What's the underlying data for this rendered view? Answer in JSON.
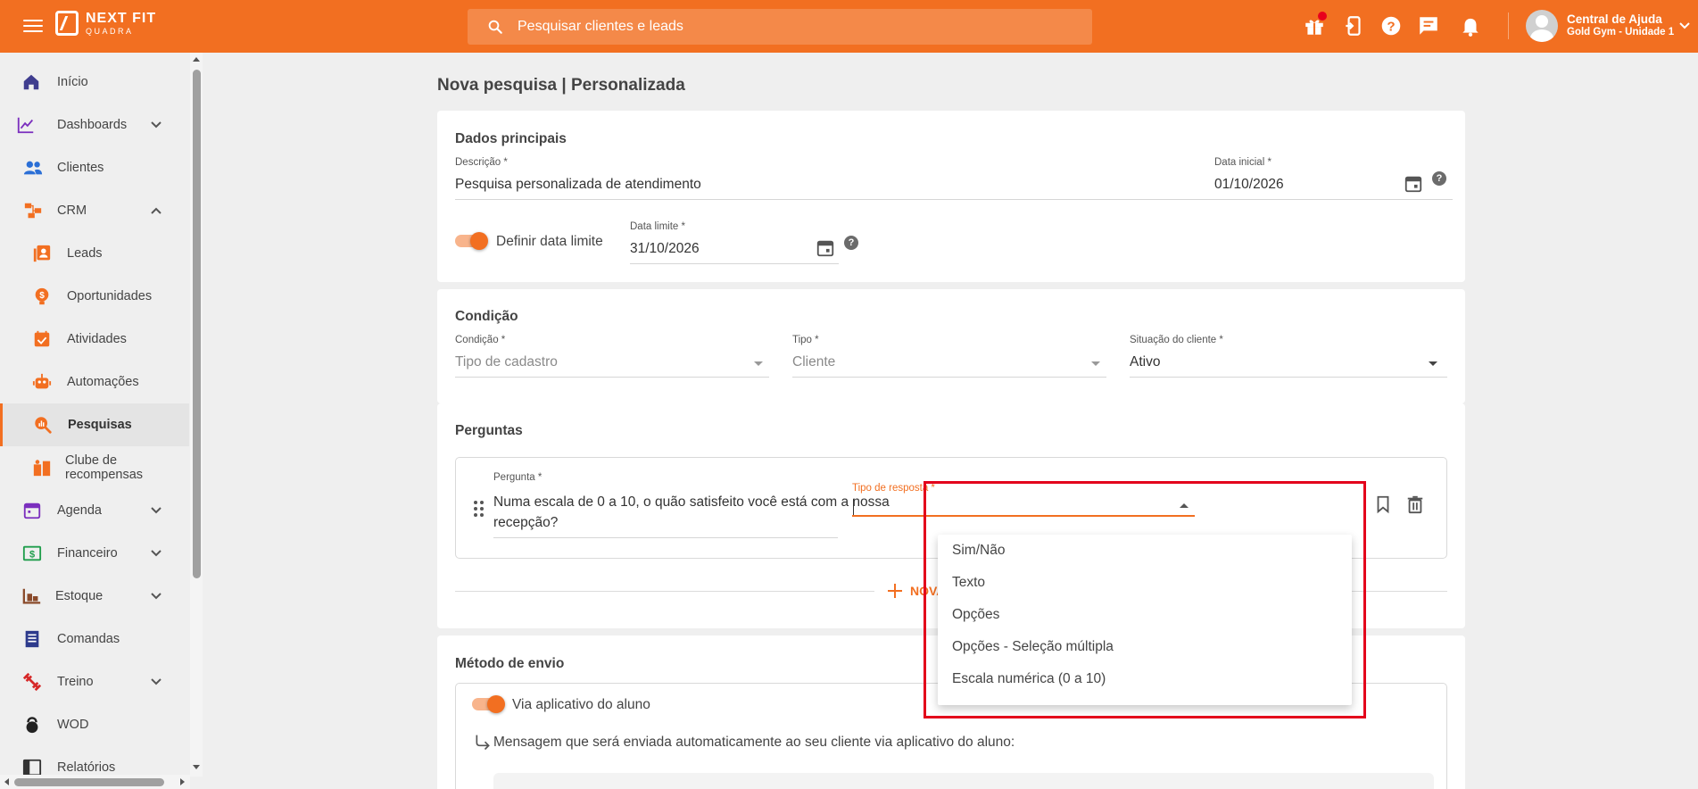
{
  "header": {
    "logo_line1": "NEXT FIT",
    "logo_line2": "QUADRA",
    "search_placeholder": "Pesquisar clientes e leads",
    "user_name": "Central de Ajuda",
    "user_unit": "Gold Gym - Unidade 1",
    "icons": [
      "menu-icon",
      "gift-icon",
      "mobile-exit-icon",
      "help-icon",
      "chat-icon",
      "bell-icon"
    ],
    "accent_color": "#f26f21"
  },
  "sidebar": {
    "items": [
      {
        "label": "Início",
        "icon": "home-icon",
        "color": "#3f3d8f"
      },
      {
        "label": "Dashboards",
        "icon": "chart-line-icon",
        "color": "#7b2fbe",
        "expandable": true
      },
      {
        "label": "Clientes",
        "icon": "people-icon",
        "color": "#2b6fd6"
      },
      {
        "label": "CRM",
        "icon": "crm-icon",
        "color": "#f26f21",
        "expandable": true,
        "expanded": true
      },
      {
        "label": "Leads",
        "icon": "contacts-icon",
        "color": "#f26f21",
        "sub": true
      },
      {
        "label": "Oportunidades",
        "icon": "lightbulb-icon",
        "color": "#f26f21",
        "sub": true
      },
      {
        "label": "Atividades",
        "icon": "calendar-check-icon",
        "color": "#f26f21",
        "sub": true
      },
      {
        "label": "Automações",
        "icon": "robot-icon",
        "color": "#f26f21",
        "sub": true
      },
      {
        "label": "Pesquisas",
        "icon": "search-chart-icon",
        "color": "#f26f21",
        "sub": true,
        "active": true
      },
      {
        "label": "Clube de recompensas",
        "icon": "rewards-icon",
        "color": "#f26f21",
        "sub": true
      },
      {
        "label": "Agenda",
        "icon": "calendar-icon",
        "color": "#7b2fbe",
        "expandable": true
      },
      {
        "label": "Financeiro",
        "icon": "money-icon",
        "color": "#1f9d4b",
        "expandable": true
      },
      {
        "label": "Estoque",
        "icon": "stock-icon",
        "color": "#8a4a2a",
        "expandable": true
      },
      {
        "label": "Comandas",
        "icon": "receipt-icon",
        "color": "#2d3a8c"
      },
      {
        "label": "Treino",
        "icon": "dumbbell-icon",
        "color": "#d62828",
        "expandable": true
      },
      {
        "label": "WOD",
        "icon": "kettlebell-icon",
        "color": "#222222"
      },
      {
        "label": "Relatórios",
        "icon": "reports-icon",
        "color": "#333333"
      }
    ]
  },
  "page": {
    "title": "Nova pesquisa | Personalizada"
  },
  "dados": {
    "title": "Dados principais",
    "descricao_label": "Descrição *",
    "descricao_value": "Pesquisa personalizada de atendimento",
    "data_inicial_label": "Data inicial *",
    "data_inicial_value": "01/10/2026",
    "definir_label": "Definir data limite",
    "definir_enabled": true,
    "data_limite_label": "Data limite *",
    "data_limite_value": "31/10/2026",
    "help": "?"
  },
  "condicao": {
    "title": "Condição",
    "condicao_label": "Condição *",
    "condicao_value": "Tipo de cadastro",
    "tipo_label": "Tipo *",
    "tipo_value": "Cliente",
    "situacao_label": "Situação do cliente *",
    "situacao_value": "Ativo"
  },
  "perguntas": {
    "title": "Perguntas",
    "pergunta_label": "Pergunta *",
    "pergunta_line1": "Numa escala de 0 a 10, o quão satisfeito você está com a nossa",
    "pergunta_line2": "recepção?",
    "tipo_resposta_label": "Tipo de resposta *",
    "tipo_resposta_value": "",
    "novo_label": "NOVA"
  },
  "dropdown": {
    "options": [
      "Sim/Não",
      "Texto",
      "Opções",
      "Opções - Seleção múltipla",
      "Escala numérica (0 a 10)"
    ]
  },
  "metodo": {
    "title": "Método de envio",
    "via_app_label": "Via aplicativo do aluno",
    "via_app_enabled": true,
    "mensagem_label": "Mensagem que será enviada automaticamente ao seu cliente via aplicativo do aluno:"
  }
}
